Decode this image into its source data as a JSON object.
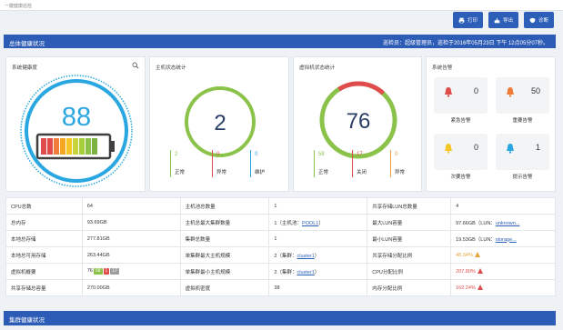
{
  "breadcrumb": "一键健康巡检",
  "toolbar": {
    "print": "打印",
    "export": "导出",
    "diagnose": "诊断"
  },
  "overall": {
    "title": "总体健康状况",
    "inspector": "巡检员：超级管理员，巡检于2016年05月23日 下午 12点05分07秒。"
  },
  "health": {
    "title": "系统健康度",
    "score": "88"
  },
  "host_stats": {
    "title": "主机状态统计",
    "total": "2",
    "items": [
      {
        "value": "2",
        "label": "正常"
      },
      {
        "value": "0",
        "label": "异常"
      },
      {
        "value": "0",
        "label": "维护"
      }
    ]
  },
  "vm_stats": {
    "title": "虚拟机状态统计",
    "total": "76",
    "items": [
      {
        "value": "58",
        "label": "正常"
      },
      {
        "value": "17",
        "label": "关闭"
      },
      {
        "value": "0",
        "label": "异常"
      }
    ]
  },
  "alarms": {
    "title": "系统告警",
    "items": [
      {
        "value": "0",
        "label": "紧急告警"
      },
      {
        "value": "50",
        "label": "重要告警"
      },
      {
        "value": "0",
        "label": "次要告警"
      },
      {
        "value": "1",
        "label": "提示告警"
      }
    ]
  },
  "info": {
    "r1": {
      "k1": "CPU总数",
      "v1": "64",
      "k2": "主机池总数量",
      "v2": "1",
      "k3": "共享存储LUN总数量",
      "v3": "4"
    },
    "r2": {
      "k1": "总内存",
      "v1": "93.69GB",
      "k2": "主机总最大集群数量",
      "v2a": "1（主机池：",
      "v2b": "POOL1",
      "v2c": "）",
      "k3": "最大LUN容量",
      "v3a": "97.66GB（LUN：",
      "v3b": "unknown..."
    },
    "r3": {
      "k1": "本地总存储",
      "v1": "277.81GB",
      "k2": "集群总数量",
      "v2": "1",
      "k3": "最小LUN容量",
      "v3a": "19.53GB（LUN：",
      "v3b": "storage..."
    },
    "r4": {
      "k1": "本地总可用存储",
      "v1": "263.44GB",
      "k2": "单集群最大主机规模",
      "v2a": "2（集群：",
      "v2b": "cluster1",
      "v2c": "）",
      "k3": "共享存储分配比例",
      "v3": "48.34%"
    },
    "r5": {
      "k1": "虚拟机概要",
      "v1": "76",
      "v1b1": "58",
      "v1b2": "1",
      "v1b3": "17",
      "k2": "单集群最小主机规模",
      "v2a": "2（集群：",
      "v2b": "cluster1",
      "v2c": "）",
      "k3": "CPU分配比例",
      "v3": "207.80%"
    },
    "r6": {
      "k1": "共享存储总容量",
      "v1": "270.00GB",
      "k2": "虚拟机密度",
      "v2": "38",
      "k3": "内存分配比例",
      "v3": "162.24%"
    }
  },
  "cluster": {
    "title": "集群健康状况"
  },
  "colors": {
    "primary": "#2d5cb6",
    "ok": "#8bc34a",
    "bad": "#e04b4b",
    "warn": "#e6a23c",
    "info": "#2aa7e0"
  }
}
